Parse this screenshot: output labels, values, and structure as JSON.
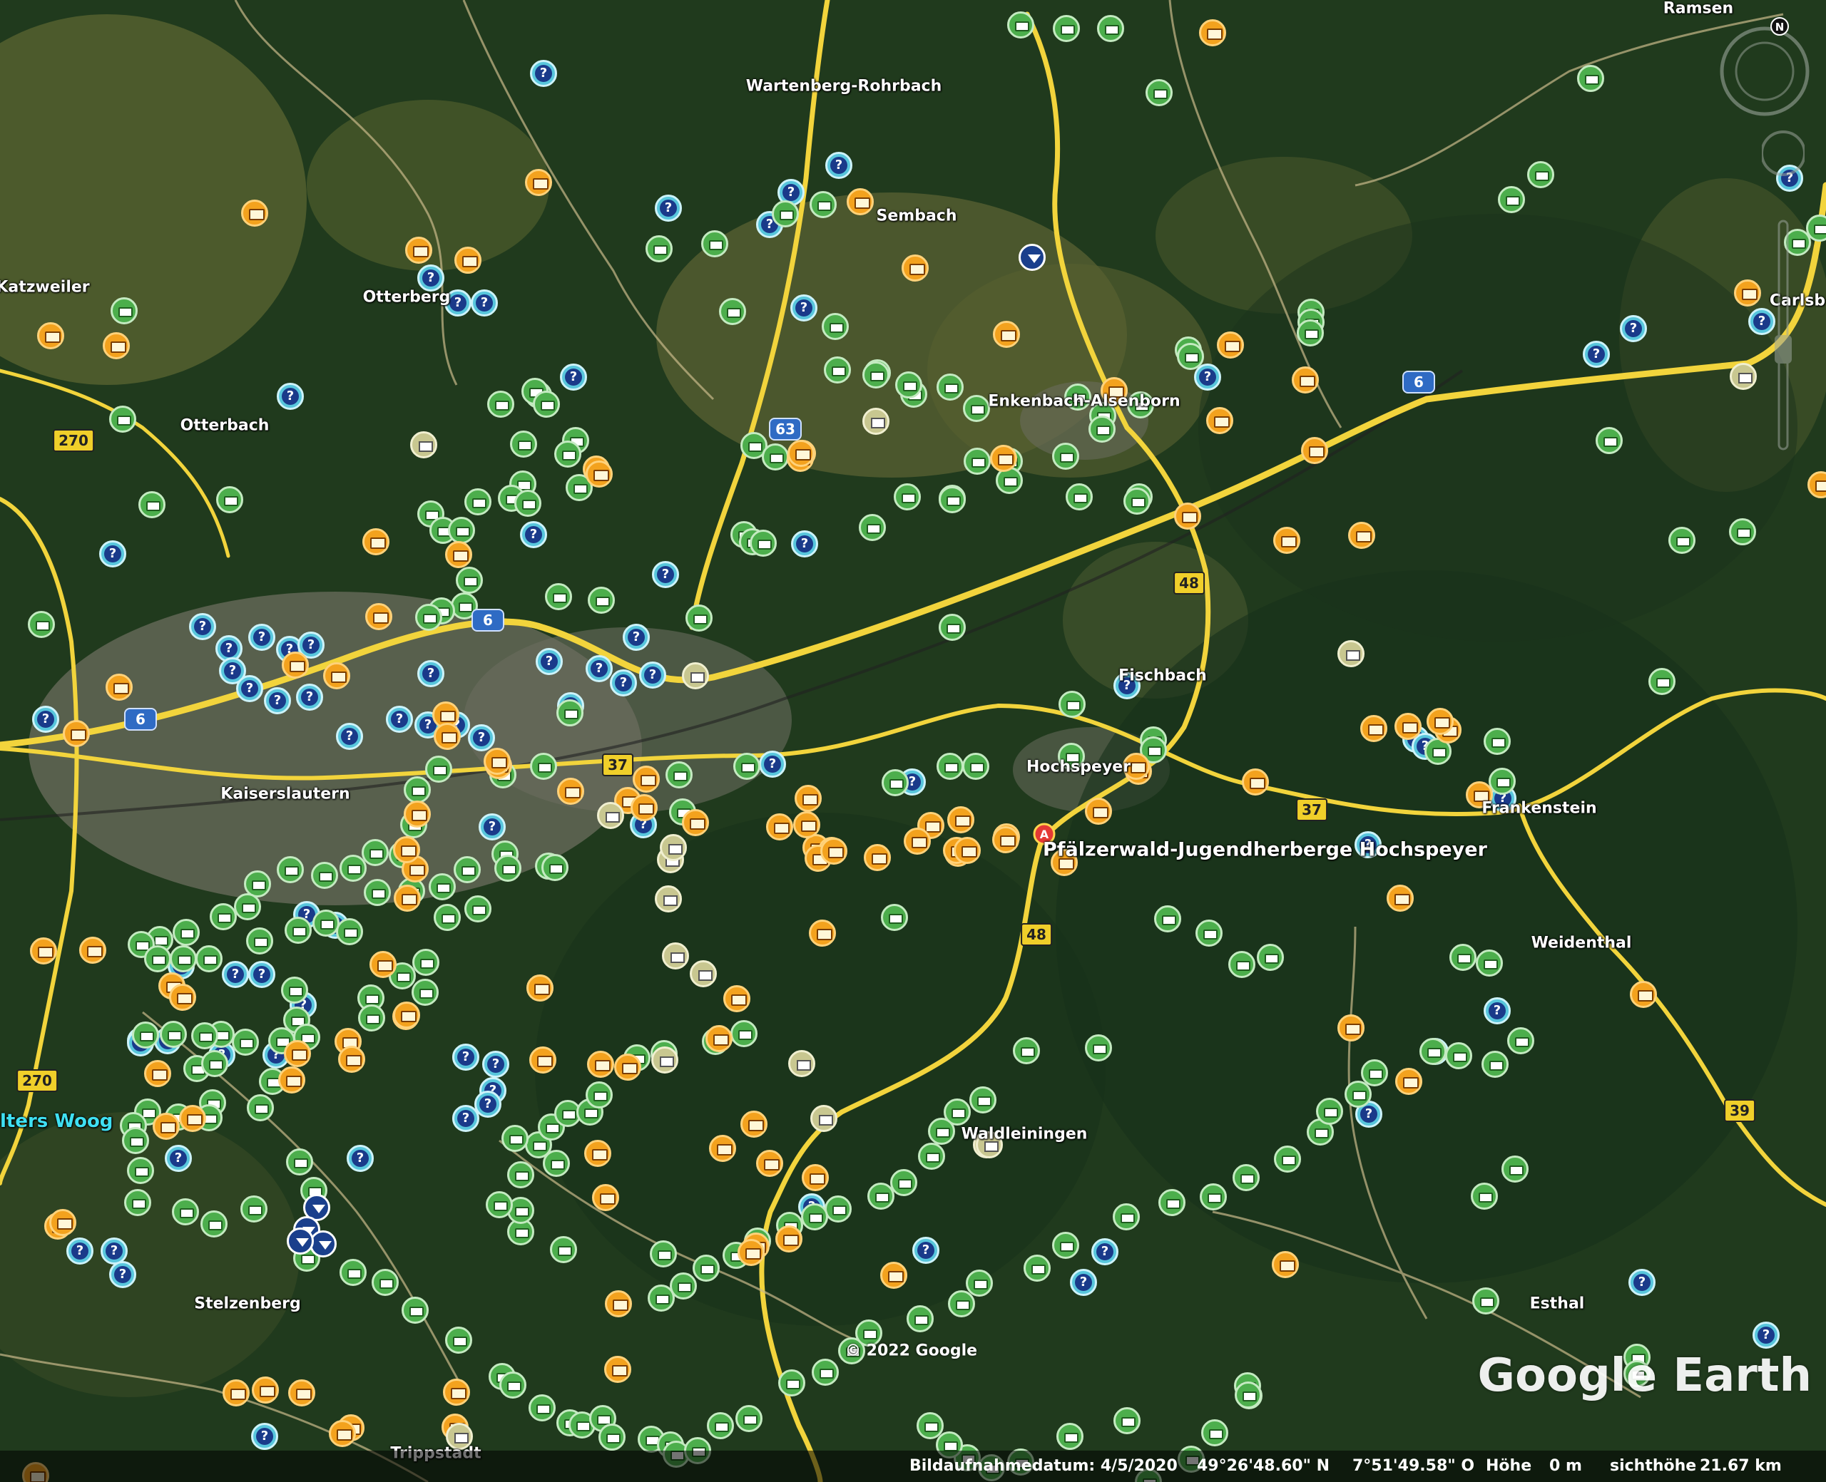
{
  "map": {
    "places": [
      {
        "id": "ramsen",
        "name": "Ramsen"
      },
      {
        "id": "wartenberg",
        "name": "Wartenberg-Rohrbach"
      },
      {
        "id": "sembach",
        "name": "Sembach"
      },
      {
        "id": "katzweiler",
        "name": "Katzweiler"
      },
      {
        "id": "otterberg",
        "name": "Otterberg"
      },
      {
        "id": "carlsberg",
        "name": "Carlsb"
      },
      {
        "id": "enkenbach",
        "name": "Enkenbach-Alsenborn"
      },
      {
        "id": "otterbach",
        "name": "Otterbach"
      },
      {
        "id": "fischbach",
        "name": "Fischbach"
      },
      {
        "id": "hochspeyer",
        "name": "Hochspeyer"
      },
      {
        "id": "kaiserslautern",
        "name": "Kaiserslautern"
      },
      {
        "id": "frankenstein",
        "name": "Frankenstein"
      },
      {
        "id": "weidenthal",
        "name": "Weidenthal"
      },
      {
        "id": "waldleiningen",
        "name": "Waldleiningen"
      },
      {
        "id": "stelzenberg",
        "name": "Stelzenberg"
      },
      {
        "id": "esthal",
        "name": "Esthal"
      },
      {
        "id": "trippstadt",
        "name": "Trippstadt"
      }
    ],
    "poi_label": "Pfälzerwald-Jugendherberge Hochspeyer",
    "pin_letter": "A",
    "water_label": "lters Woog",
    "road_shields": [
      {
        "id": "a6-ne",
        "text": "6",
        "type": "autobahn"
      },
      {
        "id": "a6-c",
        "text": "6",
        "type": "autobahn"
      },
      {
        "id": "a6-w",
        "text": "6",
        "type": "autobahn"
      },
      {
        "id": "a63",
        "text": "63",
        "type": "autobahn"
      },
      {
        "id": "b270-n",
        "text": "270",
        "type": "bundesstrasse"
      },
      {
        "id": "b270-s",
        "text": "270",
        "type": "bundesstrasse"
      },
      {
        "id": "b48-n",
        "text": "48",
        "type": "bundesstrasse"
      },
      {
        "id": "b48-s",
        "text": "48",
        "type": "bundesstrasse"
      },
      {
        "id": "b37-w",
        "text": "37",
        "type": "bundesstrasse"
      },
      {
        "id": "b37-e",
        "text": "37",
        "type": "bundesstrasse"
      },
      {
        "id": "b39",
        "text": "39",
        "type": "bundesstrasse"
      }
    ],
    "marker_types": {
      "q": "question-icon",
      "t": "tent-icon",
      "m": "shelter-icon",
      "e": "envelope-icon",
      "p": "nav-pin-icon"
    },
    "compass_letter": "N",
    "copyright": "© 2022 Google",
    "brand": "Google Earth",
    "colors": {
      "road": "#f2d43c",
      "forest": "#1f3a1c",
      "field": "#4f5a2c",
      "question": "#58c6dc",
      "tent": "#4cae4c",
      "shelter": "#f3a21e",
      "envelope": "#c8c790"
    }
  },
  "status": {
    "date_label": "Bildaufnahmedatum: 4/5/2020",
    "lat": "49°26'48.60\" N",
    "lon": "7°51'49.58\" O",
    "elev_label": "Höhe",
    "elev_value": "0 m",
    "eye_label": "sichthöhe",
    "eye_value": "21.67 km"
  }
}
